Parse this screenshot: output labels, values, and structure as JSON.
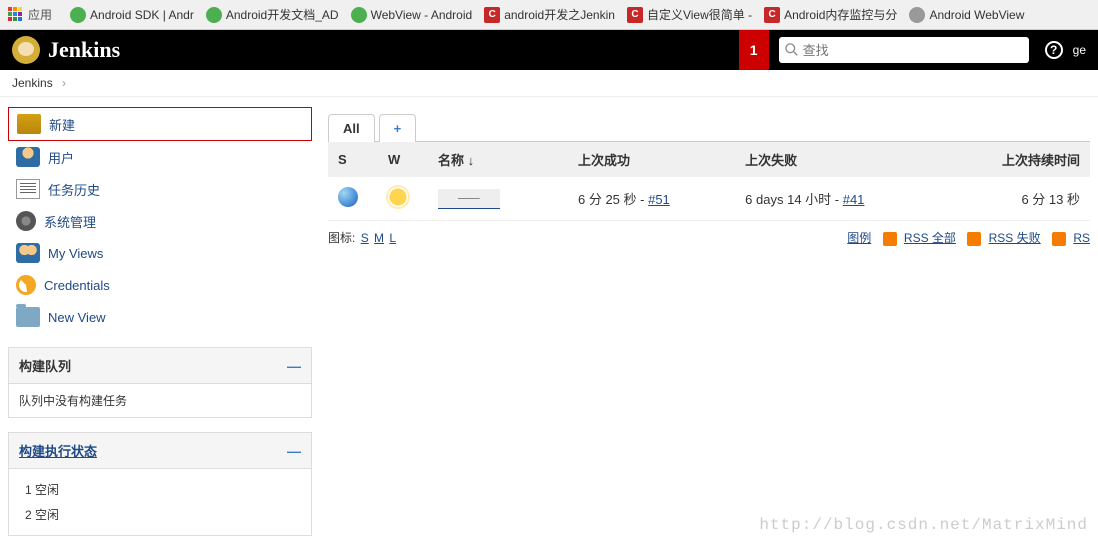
{
  "bookmarks": {
    "apps_label": "应用",
    "items": [
      {
        "label": "Android SDK | Andr",
        "icon": "green"
      },
      {
        "label": "Android开发文档_AD",
        "icon": "green"
      },
      {
        "label": "WebView - Android",
        "icon": "green"
      },
      {
        "label": "android开发之Jenkin",
        "icon": "red"
      },
      {
        "label": "自定义View很简单 -",
        "icon": "red"
      },
      {
        "label": "Android内存监控与分",
        "icon": "red"
      },
      {
        "label": "Android WebView",
        "icon": "gray"
      }
    ]
  },
  "header": {
    "title": "Jenkins",
    "notif_count": "1",
    "search_placeholder": "查找",
    "user": "ge"
  },
  "breadcrumb": {
    "items": [
      "Jenkins"
    ]
  },
  "sidebar": {
    "items": [
      {
        "label": "新建",
        "icon": "new",
        "highlighted": true
      },
      {
        "label": "用户",
        "icon": "user"
      },
      {
        "label": "任务历史",
        "icon": "history"
      },
      {
        "label": "系统管理",
        "icon": "gear"
      },
      {
        "label": "My Views",
        "icon": "views"
      },
      {
        "label": "Credentials",
        "icon": "cred"
      },
      {
        "label": "New View",
        "icon": "folder"
      }
    ]
  },
  "queue_panel": {
    "title": "构建队列",
    "empty_text": "队列中没有构建任务"
  },
  "executor_panel": {
    "title": "构建执行状态",
    "executors": [
      {
        "num": "1",
        "status": "空闲"
      },
      {
        "num": "2",
        "status": "空闲"
      }
    ]
  },
  "tabs": {
    "all": "All",
    "add": "+"
  },
  "table": {
    "headers": {
      "s": "S",
      "w": "W",
      "name": "名称 ↓",
      "last_success": "上次成功",
      "last_failure": "上次失败",
      "duration": "上次持续时间"
    },
    "rows": [
      {
        "last_success_text": "6 分 25 秒 - ",
        "last_success_build": "#51",
        "last_failure_text": "6 days 14 小时 - ",
        "last_failure_build": "#41",
        "duration": "6 分 13 秒"
      }
    ]
  },
  "icons_row": {
    "label": "图标:",
    "sizes": [
      "S",
      "M",
      "L"
    ]
  },
  "rss": {
    "legend": "图例",
    "all": "RSS 全部",
    "fail": "RSS 失败",
    "latest": "RS"
  },
  "watermark": "http://blog.csdn.net/MatrixMind"
}
